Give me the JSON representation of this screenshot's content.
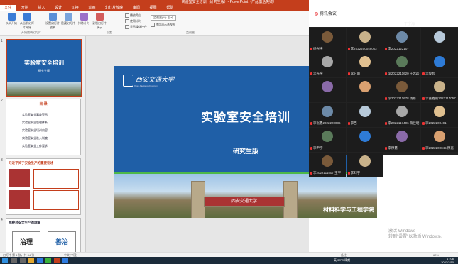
{
  "window": {
    "title": "实验室安全培训（研究生版）- PowerPoint（产品激活失败）"
  },
  "ribbon": {
    "tabs": [
      "文件",
      "开始",
      "插入",
      "设计",
      "切换",
      "动画",
      "幻灯片放映",
      "审阅",
      "视图",
      "帮助"
    ],
    "active_tab": "文件",
    "buttons": [
      "幻灯片放映",
      "排练计时",
      "录制幻灯片演示",
      "隐藏幻灯片",
      "设置幻灯片放映",
      "从头开始",
      "从当前幻灯片开始"
    ],
    "checks": [
      "播放旁白",
      "使用计时",
      "显示媒体控件"
    ],
    "dropdown": "监视器(M): 自动",
    "check_presenter": "使用演示者视图",
    "group_monitor": "监视器",
    "group_setup": "设置",
    "group_start": "开始放映幻灯片"
  },
  "thumbnails": [
    {
      "num": "1",
      "title": "实验室安全培训",
      "sub": "研究生版"
    },
    {
      "num": "2",
      "heading": "目 录",
      "items": [
        "实验室安全事故警示",
        "实验室安全管理体系",
        "实验室安全培训内容",
        "实验室安全准入制度",
        "实验室安全工作要求"
      ]
    },
    {
      "num": "3",
      "heading": "习近平关于安全生产的重要论述"
    },
    {
      "num": "4",
      "heading": "两种对安全生产的理解",
      "left": "治理",
      "right": "善治"
    }
  ],
  "slide": {
    "school": "西安交通大学",
    "school_en": "Xi'an Jiaotong University",
    "title": "实验室安全培训",
    "subtitle": "研究生版",
    "college": "材料科学与工程学院",
    "gate_text": "西安交通大学"
  },
  "meeting": {
    "brand": "腾讯会议",
    "current_user": "丁宁海",
    "participants": [
      "杨光坤",
      "李2022200049002",
      "李2022122107",
      "",
      "李光坤",
      "李方雨",
      "李2022211620 王忠磊",
      "李俊智",
      "",
      "",
      "李2022211678 杨易",
      "李张鑫雨2022117057",
      "李张鑫2022220086",
      "李西",
      "李2022117406 蒋佳明",
      "李2022200491",
      "李尹宇",
      "",
      "李穆慧",
      "李2022200045 穆嘉",
      "李2022111507 王宇",
      "李刘宇"
    ]
  },
  "statusbar": {
    "slide": "幻灯片 第 1 张，共 34 张",
    "lang": "中文(中国)",
    "notes": "备注",
    "zoom": "60%",
    "watermark_line1": "激活 Windows",
    "watermark_line2": "转到\"设置\"以激活 Windows。"
  },
  "taskbar": {
    "time": "17:06",
    "date": "2023/3/10",
    "tray": "英 38°C 晴朗"
  }
}
